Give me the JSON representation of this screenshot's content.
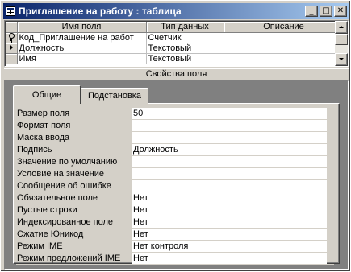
{
  "window": {
    "title": "Приглашение на работу : таблица",
    "buttons": {
      "minimize": "_",
      "maximize": "□",
      "close": "✕"
    }
  },
  "grid": {
    "headers": [
      "Имя поля",
      "Тип данных",
      "Описание"
    ],
    "rows": [
      {
        "selector": "key-icon",
        "name": "Код_Приглашение на работ",
        "type": "Счетчик",
        "description": ""
      },
      {
        "selector": "current-row-arrow-icon",
        "name": "Должность",
        "type": "Текстовый",
        "description": ""
      },
      {
        "selector": "",
        "name": "Имя",
        "type": "Текстовый",
        "description": ""
      }
    ]
  },
  "properties": {
    "title": "Свойства поля",
    "tabs": [
      "Общие",
      "Подстановка"
    ],
    "active_tab": "Общие",
    "items": [
      {
        "label": "Размер поля",
        "value": "50"
      },
      {
        "label": "Формат поля",
        "value": ""
      },
      {
        "label": "Маска ввода",
        "value": ""
      },
      {
        "label": "Подпись",
        "value": "Должность"
      },
      {
        "label": "Значение по умолчанию",
        "value": ""
      },
      {
        "label": "Условие на значение",
        "value": ""
      },
      {
        "label": "Сообщение об ошибке",
        "value": ""
      },
      {
        "label": "Обязательное поле",
        "value": "Нет"
      },
      {
        "label": "Пустые строки",
        "value": "Нет"
      },
      {
        "label": "Индексированное поле",
        "value": "Нет"
      },
      {
        "label": "Сжатие Юникод",
        "value": "Нет"
      },
      {
        "label": "Режим IME",
        "value": "Нет контроля"
      },
      {
        "label": "Режим предложений IME",
        "value": "Нет"
      }
    ]
  }
}
